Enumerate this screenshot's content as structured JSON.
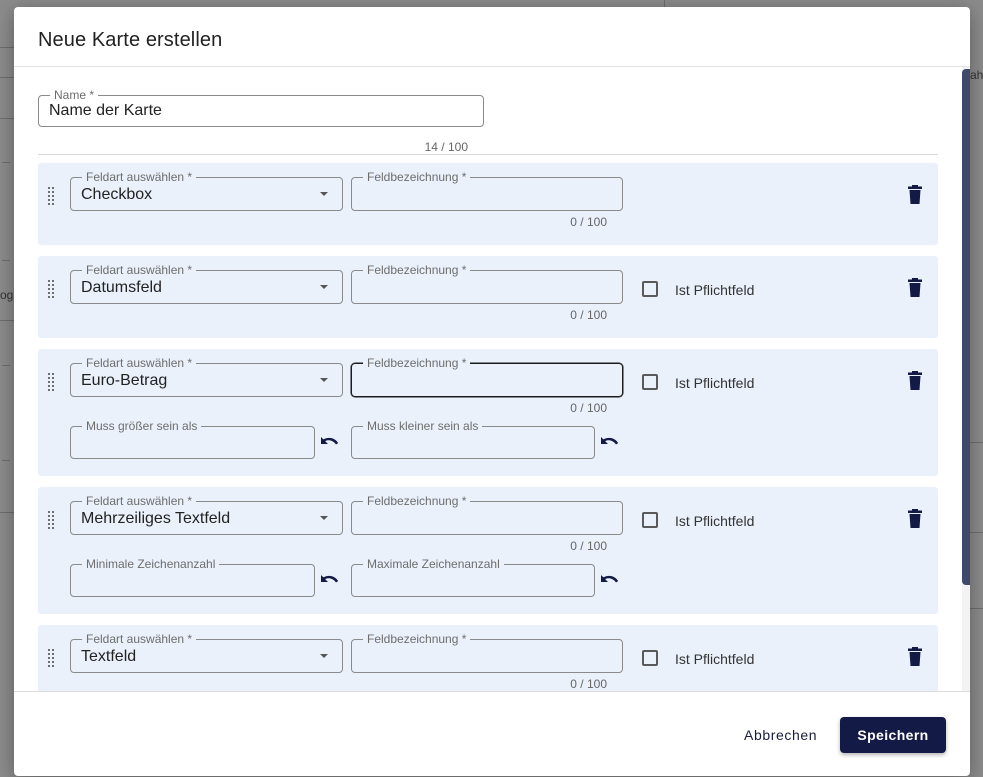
{
  "dialog": {
    "title": "Neue Karte erstellen"
  },
  "name_field": {
    "label": "Name *",
    "value": "Name der Karte",
    "counter": "14 / 100"
  },
  "field_rows": [
    {
      "type_label": "Feldart auswählen *",
      "type_value": "Checkbox",
      "desc_label": "Feldbezeichnung *",
      "desc_value": "",
      "counter": "0 / 100",
      "required_label": ""
    },
    {
      "type_label": "Feldart auswählen *",
      "type_value": "Datumsfeld",
      "desc_label": "Feldbezeichnung *",
      "desc_value": "",
      "counter": "0 / 100",
      "required_label": "Ist Pflichtfeld",
      "required_checked": false
    },
    {
      "type_label": "Feldart auswählen *",
      "type_value": "Euro-Betrag",
      "desc_label": "Feldbezeichnung *",
      "desc_value": "",
      "counter": "0 / 100",
      "required_label": "Ist Pflichtfeld",
      "required_checked": false,
      "extra": {
        "min_label": "Muss größer sein als",
        "max_label": "Muss kleiner sein als"
      }
    },
    {
      "type_label": "Feldart auswählen *",
      "type_value": "Mehrzeiliges Textfeld",
      "desc_label": "Feldbezeichnung *",
      "desc_value": "",
      "counter": "0 / 100",
      "required_label": "Ist Pflichtfeld",
      "required_checked": false,
      "extra": {
        "min_label": "Minimale Zeichenanzahl",
        "max_label": "Maximale Zeichenanzahl"
      }
    },
    {
      "type_label": "Feldart auswählen *",
      "type_value": "Textfeld",
      "desc_label": "Feldbezeichnung *",
      "desc_value": "",
      "counter": "0 / 100",
      "required_label": "Ist Pflichtfeld",
      "required_checked": false
    }
  ],
  "footer": {
    "cancel_label": "Abbrechen",
    "save_label": "Speichern"
  },
  "background": {
    "fragment_right": "ahr",
    "fragment_left": "og"
  },
  "icons": {
    "delete": "trash-icon",
    "drag": "drag-handle-icon",
    "reset": "undo-icon",
    "dropdown": "dropdown-arrow-icon"
  },
  "colors": {
    "primary": "#141a46",
    "card_bg": "#eaf1fb",
    "scrollbar": "#3f4a6b"
  }
}
